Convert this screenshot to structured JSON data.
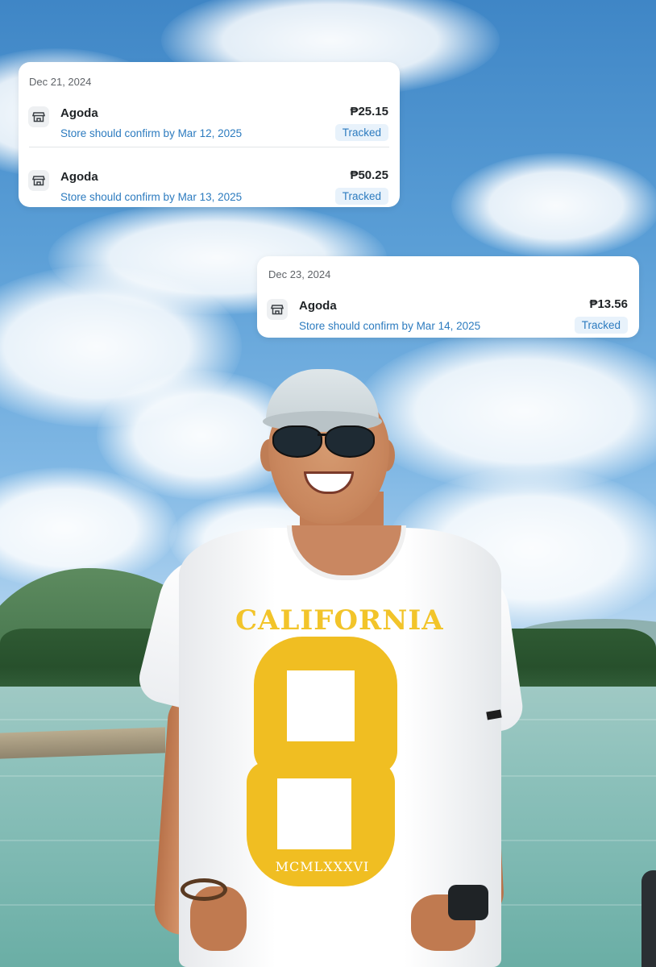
{
  "currency_symbol": "₱",
  "accent_color": "#2c7bbf",
  "groups": [
    {
      "date": "Dec 21, 2024",
      "items": [
        {
          "merchant": "Agoda",
          "subtitle": "Store should confirm by Mar 12, 2025",
          "amount": "₱25.15",
          "status": "Tracked",
          "icon": "store-icon"
        },
        {
          "merchant": "Agoda",
          "subtitle": "Store should confirm by Mar 13, 2025",
          "amount": "₱50.25",
          "status": "Tracked",
          "icon": "store-icon"
        }
      ]
    },
    {
      "date": "Dec 23, 2024",
      "items": [
        {
          "merchant": "Agoda",
          "subtitle": "Store should confirm by Mar 14, 2025",
          "amount": "₱13.56",
          "status": "Tracked",
          "icon": "store-icon"
        }
      ]
    }
  ],
  "photo": {
    "shirt_text": "CALIFORNIA",
    "shirt_number": "8",
    "shirt_roman": "MCMLXXXVI"
  }
}
